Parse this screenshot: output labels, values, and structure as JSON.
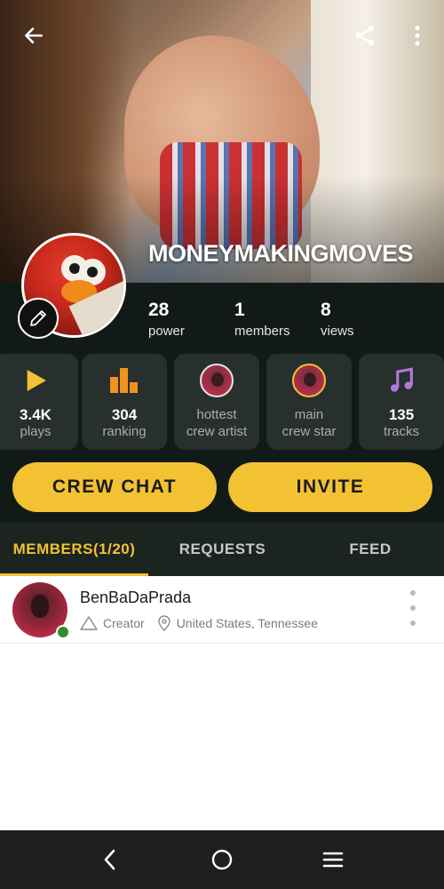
{
  "header": {
    "crew_name": "MONEYMAKINGMOVES",
    "back_icon": "arrow-left-icon",
    "share_icon": "share-icon",
    "more_icon": "more-vertical-icon"
  },
  "stats": {
    "power": {
      "value": "28",
      "label": "power"
    },
    "members": {
      "value": "1",
      "label": "members"
    },
    "views": {
      "value": "8",
      "label": "views"
    }
  },
  "cards": {
    "plays": {
      "value": "3.4K",
      "label": "plays",
      "icon": "play-icon"
    },
    "ranking": {
      "value": "304",
      "label": "ranking",
      "icon": "bar-chart-icon"
    },
    "hottest_artist": {
      "label_line1": "hottest",
      "label_line2": "crew artist"
    },
    "main_star": {
      "label_line1": "main",
      "label_line2": "crew star"
    },
    "tracks": {
      "value": "135",
      "label": "tracks",
      "icon": "music-note-icon"
    }
  },
  "actions": {
    "crew_chat": "CREW CHAT",
    "invite": "INVITE"
  },
  "tabs": {
    "members": "MEMBERS(1/20)",
    "requests": "REQUESTS",
    "feed": "FEED"
  },
  "members": [
    {
      "name": "BenBaDaPrada",
      "role": "Creator",
      "location": "United States, Tennessee",
      "online": true
    }
  ],
  "colors": {
    "accent": "#f2c233",
    "dark_bg": "#121a17",
    "card_bg": "#27302c",
    "online": "#2e8b2e"
  }
}
